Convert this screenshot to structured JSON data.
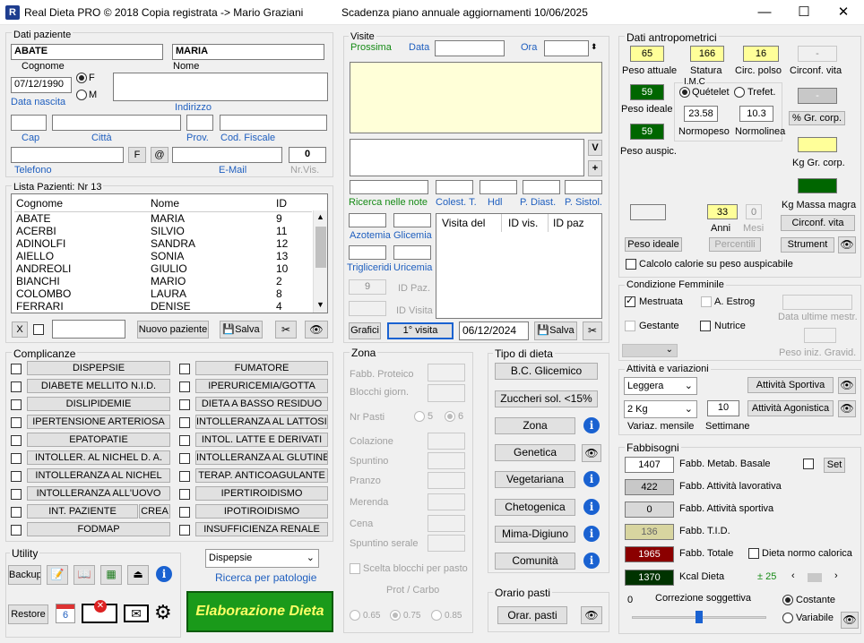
{
  "app": {
    "title": "Real Dieta PRO © 2018 Copia registrata ->  Mario Graziani",
    "expiry": "Scadenza piano annuale aggiornamenti  10/06/2025",
    "minimize": "—",
    "maximize": "☐",
    "close": "✕"
  },
  "patient": {
    "section": "Dati paziente",
    "surname": "ABATE",
    "name": "MARIA",
    "surname_label": "Cognome",
    "name_label": "Nome",
    "birth": "07/12/1990",
    "birth_label": "Data nascita",
    "sex_f": "F",
    "sex_m": "M",
    "address_label": "Indirizzo",
    "cap_label": "Cap",
    "city_label": "Città",
    "prov_label": "Prov.",
    "fiscal_label": "Cod. Fiscale",
    "phone_label": "Telefono",
    "email_label": "E-Mail",
    "f_btn": "F",
    "at_btn": "@",
    "nrvis": "0",
    "nrvis_label": "Nr.Vis."
  },
  "list": {
    "title": "Lista Pazienti:  Nr 13",
    "headers": [
      "Cognome",
      "Nome",
      "ID"
    ],
    "rows": [
      [
        "ABATE",
        "MARIA",
        "9"
      ],
      [
        "ACERBI",
        "SILVIO",
        "11"
      ],
      [
        "ADINOLFI",
        "SANDRA",
        "12"
      ],
      [
        "AIELLO",
        "SONIA",
        "13"
      ],
      [
        "ANDREOLI",
        "GIULIO",
        "10"
      ],
      [
        "BIANCHI",
        "MARIO",
        "2"
      ],
      [
        "COLOMBO",
        "LAURA",
        "8"
      ],
      [
        "FERRARI",
        "DENISE",
        "4"
      ]
    ],
    "x_btn": "X",
    "new_btn": "Nuovo paziente",
    "save_btn": "Salva"
  },
  "complicanze": {
    "title": "Complicanze",
    "left": [
      "DISPEPSIE",
      "DIABETE MELLITO N.I.D.",
      "DISLIPIDEMIE",
      "IPERTENSIONE ARTERIOSA",
      "EPATOPATIE",
      "INTOLLER. AL NICHEL  D. A.",
      "INTOLLERANZA  AL NICHEL",
      "INTOLLERANZA ALL'UOVO",
      "INT. PAZIENTE",
      "FODMAP"
    ],
    "crea": "CREA",
    "right": [
      "FUMATORE",
      "IPERURICEMIA/GOTTA",
      "DIETA  A BASSO RESIDUO",
      "INTOLLERANZA AL LATTOSIO",
      "INTOL. LATTE E DERIVATI",
      "INTOLLERANZA AL GLUTINE",
      "TERAP.  ANTICOAGULANTE",
      "IPERTIROIDISMO",
      "IPOTIROIDISMO",
      "INSUFFICIENZA RENALE"
    ]
  },
  "utility": {
    "title": "Utility",
    "backup": "Backup",
    "restore": "Restore",
    "calendar": "6",
    "pathology_select": "Dispepsie",
    "pathology_link": "Ricerca per patologie",
    "elaborate": "Elaborazione Dieta"
  },
  "visits": {
    "title": "Visite",
    "next": "Prossima",
    "date_label": "Data",
    "time_label": "Ora",
    "v_btn": "V",
    "plus_btn": "+",
    "search_notes": "Ricerca nelle note",
    "colest": "Colest. T.",
    "hdl": "Hdl",
    "pdiast": "P. Diast.",
    "psist": "P. Sistol.",
    "azotemia": "Azotemia",
    "glicemia": "Glicemia",
    "trig": "Trigliceridi",
    "uric": "Uricemia",
    "idpaz_val": "9",
    "idpaz_label": "ID Paz.",
    "idvis_label": "ID Visita",
    "table_headers": [
      "Visita del",
      "ID vis.",
      "ID paz"
    ],
    "charts_btn": "Grafici",
    "first_visit_btn": "1° visita",
    "visit_date": "06/12/2024",
    "save_btn": "Salva"
  },
  "zona": {
    "title": "Zona",
    "fabb_prot": "Fabb. Proteico",
    "blocchi": "Blocchi giorn.",
    "nr_pasti": "Nr Pasti",
    "opt5": "5",
    "opt6": "6",
    "meals": [
      "Colazione",
      "Spuntino",
      "Pranzo",
      "Merenda",
      "Cena",
      "Spuntino serale"
    ],
    "scelta": "Scelta blocchi per pasto",
    "protcarbo": "Prot / Carbo",
    "r1": "0.65",
    "r2": "0.75",
    "r3": "0.85"
  },
  "diet_type": {
    "title": "Tipo di dieta",
    "items": [
      "B.C. Glicemico",
      "Zuccheri sol. <15%",
      "Zona",
      "Genetica",
      "Vegetariana",
      "Chetogenica",
      "Mima-Digiuno",
      "Comunità"
    ]
  },
  "orario": {
    "title": "Orario pasti",
    "btn": "Orar. pasti"
  },
  "anthro": {
    "title": "Dati antropometrici",
    "peso": "65",
    "statura": "166",
    "polso": "16",
    "vita_val": "-",
    "peso_label": "Peso attuale",
    "statura_label": "Statura",
    "polso_label": "Circ. polso",
    "vita_label": "Circonf. vita",
    "peso_ideale": "59",
    "peso_ideale_label": "Peso ideale",
    "imc": "I.M.C",
    "quetel": "Quételet",
    "trefet": "Trefet.",
    "quetel_val": "23.58",
    "trefet_val": "10.3",
    "normopeso": "Normopeso",
    "normolinea": "Normolinea",
    "peso_auspic": "59",
    "peso_auspic_label": "Peso auspic.",
    "gr_corp_btn": "% Gr. corp.",
    "kg_gr_label": "Kg Gr. corp.",
    "kg_mm_label": "Kg Massa magra",
    "gr_val": "-",
    "anni": "33",
    "anni_label": "Anni",
    "mesi": "0",
    "mesi_label": "Mesi",
    "circ_vita_btn": "Circonf. vita",
    "peso_ideale_btn": "Peso ideale",
    "percentili_btn": "Percentili",
    "strument_btn": "Strument",
    "calc": "Calcolo calorie su peso auspicabile"
  },
  "female": {
    "title": "Condizione Femminile",
    "mestruata": "Mestruata",
    "estrog": "A. Estrog",
    "gestante": "Gestante",
    "nutrice": "Nutrice",
    "ultime": "Data ultime mestr.",
    "peso_iniz": "Peso iniz. Gravid."
  },
  "activity": {
    "title": "Attività e variazioni",
    "level": "Leggera",
    "sport_btn": "Attività Sportiva",
    "variation": "2 Kg",
    "weeks": "10",
    "agon_btn": "Attività Agonistica",
    "var_label": "Variaz. mensile",
    "weeks_label": "Settimane"
  },
  "needs": {
    "title": "Fabbisogni",
    "basal": "1407",
    "basal_label": "Fabb. Metab. Basale",
    "set_btn": "Set",
    "work": "422",
    "work_label": "Fabb. Attività lavorativa",
    "sport": "0",
    "sport_label": "Fabb. Attività sportiva",
    "tid": "136",
    "tid_label": "Fabb. T.I.D.",
    "total": "1965",
    "total_label": "Fabb. Totale",
    "normocal": "Dieta normo calorica",
    "kcal": "1370",
    "kcal_label": "Kcal Dieta",
    "pm": "± 25",
    "corr_val": "0",
    "corr_label": "Correzione soggettiva",
    "costante": "Costante",
    "variabile": "Variabile"
  },
  "colors": {
    "yellow": "#ffff99",
    "green": "#006600",
    "grn_text": "#ffffff",
    "red": "#8b0000",
    "olive": "#d8d5a0",
    "gray": "#c8c8c8"
  }
}
